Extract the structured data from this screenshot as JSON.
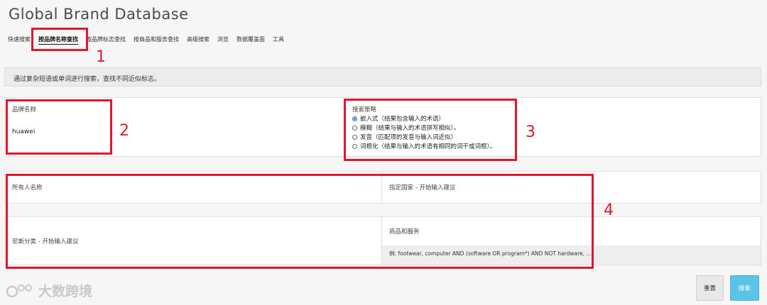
{
  "app": {
    "title": "Global Brand Database"
  },
  "tabs": [
    {
      "label": "快速搜索",
      "active": false
    },
    {
      "label": "按品牌名称查找",
      "active": true
    },
    {
      "label": "按品牌标志查找",
      "active": false
    },
    {
      "label": "按商品和服务查找",
      "active": false
    },
    {
      "label": "高级搜索",
      "active": false
    },
    {
      "label": "浏览",
      "active": false
    },
    {
      "label": "数据覆盖面",
      "active": false
    },
    {
      "label": "工具",
      "active": false
    }
  ],
  "description": "通过复杂短语或单词进行搜索，查找不同近似标志。",
  "brand_name": {
    "label": "品牌名称",
    "value": "huawei"
  },
  "strategy": {
    "label": "搜索策略",
    "options": [
      {
        "label": "嵌入式（结果包含输入的术语）",
        "selected": true
      },
      {
        "label": "模糊（结果与输入的术语拼写相似）。",
        "selected": false
      },
      {
        "label": "发音（匹配项的发音与输入词近似）",
        "selected": false
      },
      {
        "label": "词根化（结果与输入的术语有相同的词干或词根）。",
        "selected": false
      }
    ]
  },
  "filters": {
    "owner_label": "所有人名称",
    "country_label": "指定国家 - 开始输入建议",
    "nice_label": "尼斯分类 - 开始输入建议",
    "goods_label": "商品和服务",
    "goods_hint": "例: footwear, computer AND (software OR program*) AND NOT hardware, ..."
  },
  "buttons": {
    "reset": "重置",
    "search": "搜索"
  },
  "annotations": {
    "n1": "1",
    "n2": "2",
    "n3": "3",
    "n4": "4",
    "color": "#e0182d"
  },
  "watermark": {
    "text": "大数跨境"
  },
  "colors": {
    "search_button": "#5bc4e6",
    "radio_selected": "#2a5fb5"
  }
}
